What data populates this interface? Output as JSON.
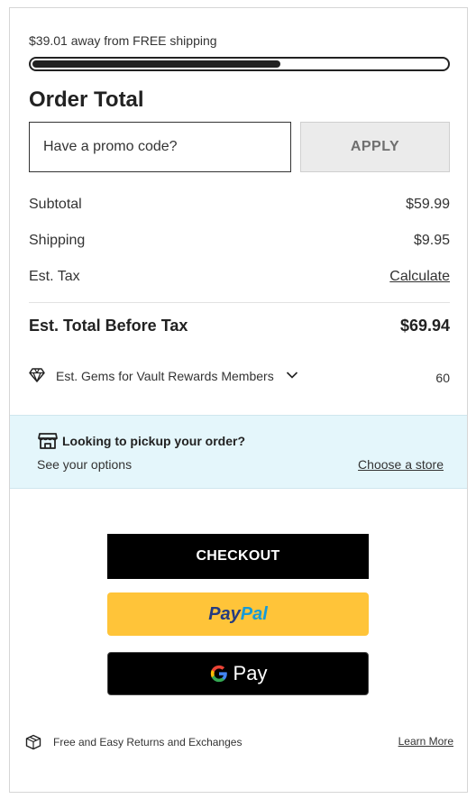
{
  "shipping": {
    "message": "$39.01 away from FREE shipping",
    "progress_fraction": 0.6
  },
  "order": {
    "title": "Order Total",
    "promo_placeholder": "Have a promo code?",
    "apply_label": "APPLY"
  },
  "summary": {
    "subtotal_label": "Subtotal",
    "subtotal_value": "$59.99",
    "shipping_label": "Shipping",
    "shipping_value": "$9.95",
    "tax_label": "Est. Tax",
    "tax_value": "Calculate",
    "total_label": "Est. Total Before Tax",
    "total_value": "$69.94",
    "gems_label": "Est. Gems for Vault Rewards Members",
    "gems_value": "60"
  },
  "pickup": {
    "title": "Looking to pickup your order?",
    "subtitle": "See your options",
    "link": "Choose a store"
  },
  "buttons": {
    "checkout": "CHECKOUT",
    "paypal_part1": "Pay",
    "paypal_part2": "Pal",
    "gpay": "Pay"
  },
  "returns": {
    "text": "Free and Easy Returns and Exchanges",
    "link": "Learn More"
  },
  "colors": {
    "pickup_bg": "#e4f6fb",
    "paypal_yellow": "#ffc439",
    "paypal_dark_blue": "#253b80",
    "paypal_light_blue": "#179bd7"
  },
  "icons": [
    "gem-icon",
    "chevron-down-icon",
    "store-icon",
    "google-g-icon",
    "box-icon"
  ]
}
